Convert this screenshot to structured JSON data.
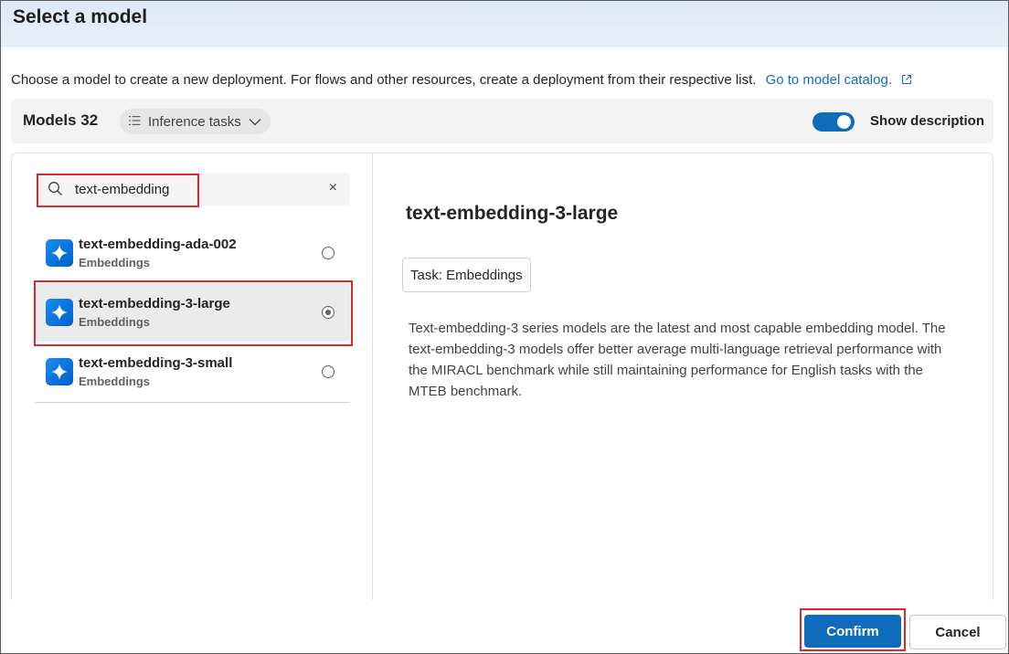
{
  "dialog": {
    "title": "Select a model",
    "intro_text": "Choose a model to create a new deployment. For flows and other resources, create a deployment from their respective list.",
    "catalog_link": "Go to model catalog."
  },
  "toolbar": {
    "models_label": "Models 32",
    "filter_label": "Inference tasks",
    "toggle_label": "Show description",
    "toggle_on": true
  },
  "search": {
    "value": "text-embedding",
    "clear_symbol": "×"
  },
  "models": [
    {
      "name": "text-embedding-ada-002",
      "task": "Embeddings",
      "selected": false
    },
    {
      "name": "text-embedding-3-large",
      "task": "Embeddings",
      "selected": true
    },
    {
      "name": "text-embedding-3-small",
      "task": "Embeddings",
      "selected": false
    }
  ],
  "detail": {
    "title": "text-embedding-3-large",
    "task_chip": "Task: Embeddings",
    "description": "Text-embedding-3 series models are the latest and most capable embedding model. The text-embedding-3 models offer better average multi-language retrieval performance with the MIRACL benchmark while still maintaining performance for English tasks with the MTEB benchmark."
  },
  "footer": {
    "confirm_label": "Confirm",
    "cancel_label": "Cancel"
  },
  "colors": {
    "accent": "#0f6cbd",
    "highlight": "#e0262e"
  },
  "icons": {
    "search": "search-icon",
    "external_link": "external-link-icon",
    "filter": "filter-list-icon",
    "chevron": "chevron-down-icon",
    "model_logo": "sparkle-icon"
  }
}
